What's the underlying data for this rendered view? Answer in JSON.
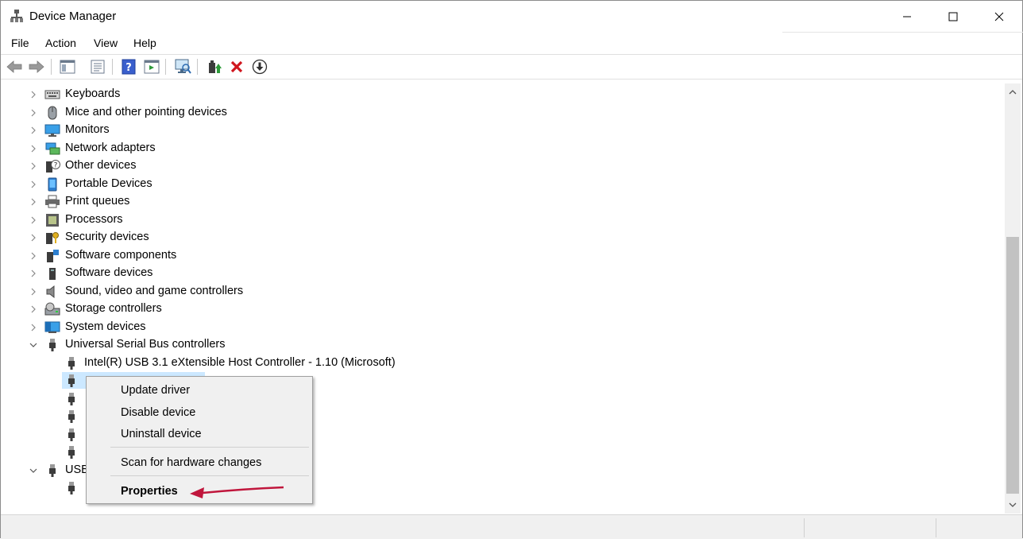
{
  "window": {
    "title": "Device Manager"
  },
  "menu": {
    "items": [
      "File",
      "Action",
      "View",
      "Help"
    ]
  },
  "tree": {
    "categories": [
      {
        "label": "Keyboards",
        "icon": "keyboard-icon"
      },
      {
        "label": "Mice and other pointing devices",
        "icon": "mouse-icon"
      },
      {
        "label": "Monitors",
        "icon": "monitor-icon"
      },
      {
        "label": "Network adapters",
        "icon": "network-icon"
      },
      {
        "label": "Other devices",
        "icon": "unknown-device-icon"
      },
      {
        "label": "Portable Devices",
        "icon": "portable-device-icon"
      },
      {
        "label": "Print queues",
        "icon": "printer-icon"
      },
      {
        "label": "Processors",
        "icon": "processor-icon"
      },
      {
        "label": "Security devices",
        "icon": "security-device-icon"
      },
      {
        "label": "Software components",
        "icon": "software-component-icon"
      },
      {
        "label": "Software devices",
        "icon": "software-device-icon"
      },
      {
        "label": "Sound, video and game controllers",
        "icon": "speaker-icon"
      },
      {
        "label": "Storage controllers",
        "icon": "storage-icon"
      },
      {
        "label": "System devices",
        "icon": "system-icon"
      },
      {
        "label": "Universal Serial Bus controllers",
        "icon": "usb-icon",
        "expanded": true
      }
    ],
    "usb_children": [
      {
        "label": "Intel(R) USB 3.1 eXtensible Host Controller - 1.10 (Microsoft)"
      },
      {
        "label": ""
      },
      {
        "label": ""
      },
      {
        "label": ""
      },
      {
        "label": ""
      },
      {
        "label": ""
      }
    ],
    "last_category": {
      "label": "USB",
      "icon": "usb-icon",
      "expanded": true
    },
    "last_child": {
      "label": ""
    }
  },
  "context_menu": {
    "update": "Update driver",
    "disable": "Disable device",
    "uninstall": "Uninstall device",
    "scan": "Scan for hardware changes",
    "properties": "Properties"
  },
  "colors": {
    "selection": "#cce8ff",
    "annotation_arrow": "#c0163c"
  }
}
